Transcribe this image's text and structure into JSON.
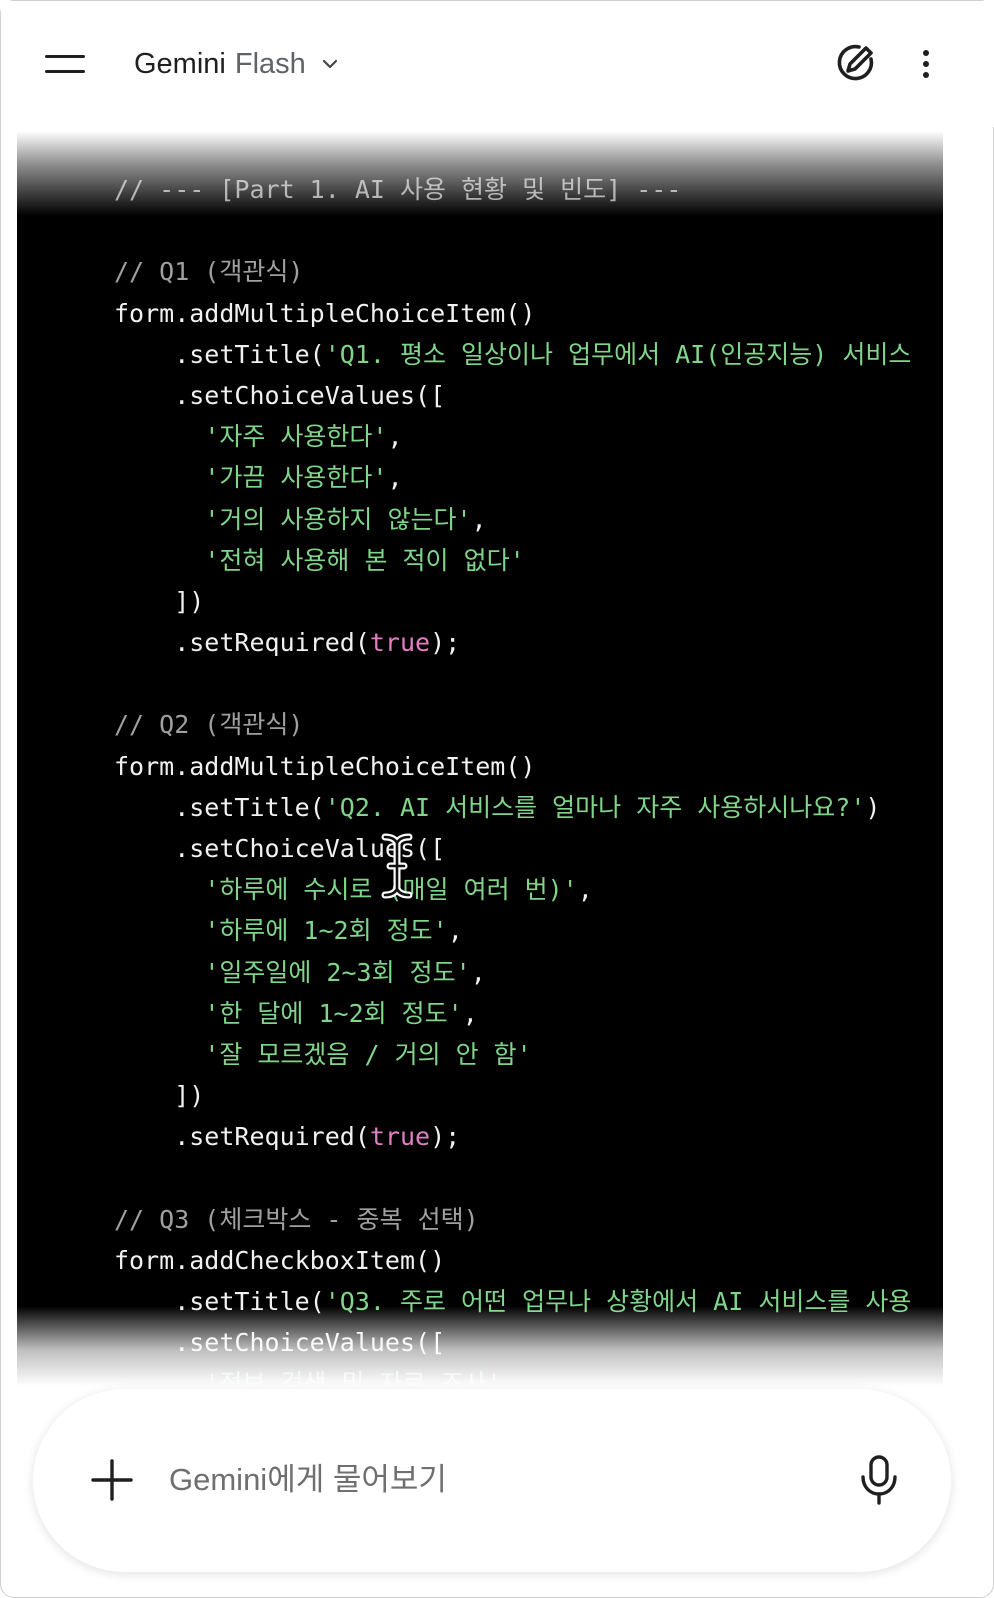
{
  "header": {
    "model_name": "Gemini",
    "model_tier": "Flash",
    "icons": {
      "menu": "menu-icon",
      "chevron": "chevron-down-icon",
      "new_chat": "edit-pen-icon",
      "more": "more-vert-icon"
    }
  },
  "code": {
    "colors": {
      "background": "#000000",
      "plain": "#f1f1f1",
      "comment": "#a0a0a0",
      "string": "#7fd68a",
      "keyword": "#e27ec4"
    },
    "lines": [
      [
        {
          "t": "// --- [Part 1. AI 사용 현황 및 빈도] ---",
          "k": "comment"
        }
      ],
      [],
      [
        {
          "t": "// Q1 (객관식)",
          "k": "comment"
        }
      ],
      [
        {
          "t": "form.addMultipleChoiceItem()",
          "k": "plain"
        }
      ],
      [
        {
          "t": "    .setTitle(",
          "k": "plain"
        },
        {
          "t": "'Q1. 평소 일상이나 업무에서 AI(인공지능) 서비스",
          "k": "string"
        }
      ],
      [
        {
          "t": "    .setChoiceValues([",
          "k": "plain"
        }
      ],
      [
        {
          "t": "      ",
          "k": "plain"
        },
        {
          "t": "'자주 사용한다'",
          "k": "string"
        },
        {
          "t": ",",
          "k": "plain"
        }
      ],
      [
        {
          "t": "      ",
          "k": "plain"
        },
        {
          "t": "'가끔 사용한다'",
          "k": "string"
        },
        {
          "t": ",",
          "k": "plain"
        }
      ],
      [
        {
          "t": "      ",
          "k": "plain"
        },
        {
          "t": "'거의 사용하지 않는다'",
          "k": "string"
        },
        {
          "t": ",",
          "k": "plain"
        }
      ],
      [
        {
          "t": "      ",
          "k": "plain"
        },
        {
          "t": "'전혀 사용해 본 적이 없다'",
          "k": "string"
        }
      ],
      [
        {
          "t": "    ])",
          "k": "plain"
        }
      ],
      [
        {
          "t": "    .setRequired(",
          "k": "plain"
        },
        {
          "t": "true",
          "k": "keyword"
        },
        {
          "t": ");",
          "k": "plain"
        }
      ],
      [],
      [
        {
          "t": "// Q2 (객관식)",
          "k": "comment"
        }
      ],
      [
        {
          "t": "form.addMultipleChoiceItem()",
          "k": "plain"
        }
      ],
      [
        {
          "t": "    .setTitle(",
          "k": "plain"
        },
        {
          "t": "'Q2. AI 서비스를 얼마나 자주 사용하시나요?'",
          "k": "string"
        },
        {
          "t": ")",
          "k": "plain"
        }
      ],
      [
        {
          "t": "    .setChoiceValues([",
          "k": "plain"
        }
      ],
      [
        {
          "t": "      ",
          "k": "plain"
        },
        {
          "t": "'하루에 수시로 (매일 여러 번)'",
          "k": "string"
        },
        {
          "t": ",",
          "k": "plain"
        }
      ],
      [
        {
          "t": "      ",
          "k": "plain"
        },
        {
          "t": "'하루에 1~2회 정도'",
          "k": "string"
        },
        {
          "t": ",",
          "k": "plain"
        }
      ],
      [
        {
          "t": "      ",
          "k": "plain"
        },
        {
          "t": "'일주일에 2~3회 정도'",
          "k": "string"
        },
        {
          "t": ",",
          "k": "plain"
        }
      ],
      [
        {
          "t": "      ",
          "k": "plain"
        },
        {
          "t": "'한 달에 1~2회 정도'",
          "k": "string"
        },
        {
          "t": ",",
          "k": "plain"
        }
      ],
      [
        {
          "t": "      ",
          "k": "plain"
        },
        {
          "t": "'잘 모르겠음 / 거의 안 함'",
          "k": "string"
        }
      ],
      [
        {
          "t": "    ])",
          "k": "plain"
        }
      ],
      [
        {
          "t": "    .setRequired(",
          "k": "plain"
        },
        {
          "t": "true",
          "k": "keyword"
        },
        {
          "t": ");",
          "k": "plain"
        }
      ],
      [],
      [
        {
          "t": "// Q3 (체크박스 - 중복 선택)",
          "k": "comment"
        }
      ],
      [
        {
          "t": "form.addCheckboxItem()",
          "k": "plain"
        }
      ],
      [
        {
          "t": "    .setTitle(",
          "k": "plain"
        },
        {
          "t": "'Q3. 주로 어떤 업무나 상황에서 AI 서비스를 사용",
          "k": "string"
        }
      ],
      [
        {
          "t": "    .setChoiceValues([",
          "k": "plain"
        }
      ],
      [
        {
          "t": "      ",
          "k": "plain"
        },
        {
          "t": "'정보 검색 및 자료 조사'",
          "k": "string"
        }
      ]
    ]
  },
  "composer": {
    "placeholder": "Gemini에게 물어보기",
    "value": "",
    "icons": {
      "add": "plus-icon",
      "mic": "microphone-icon"
    }
  }
}
